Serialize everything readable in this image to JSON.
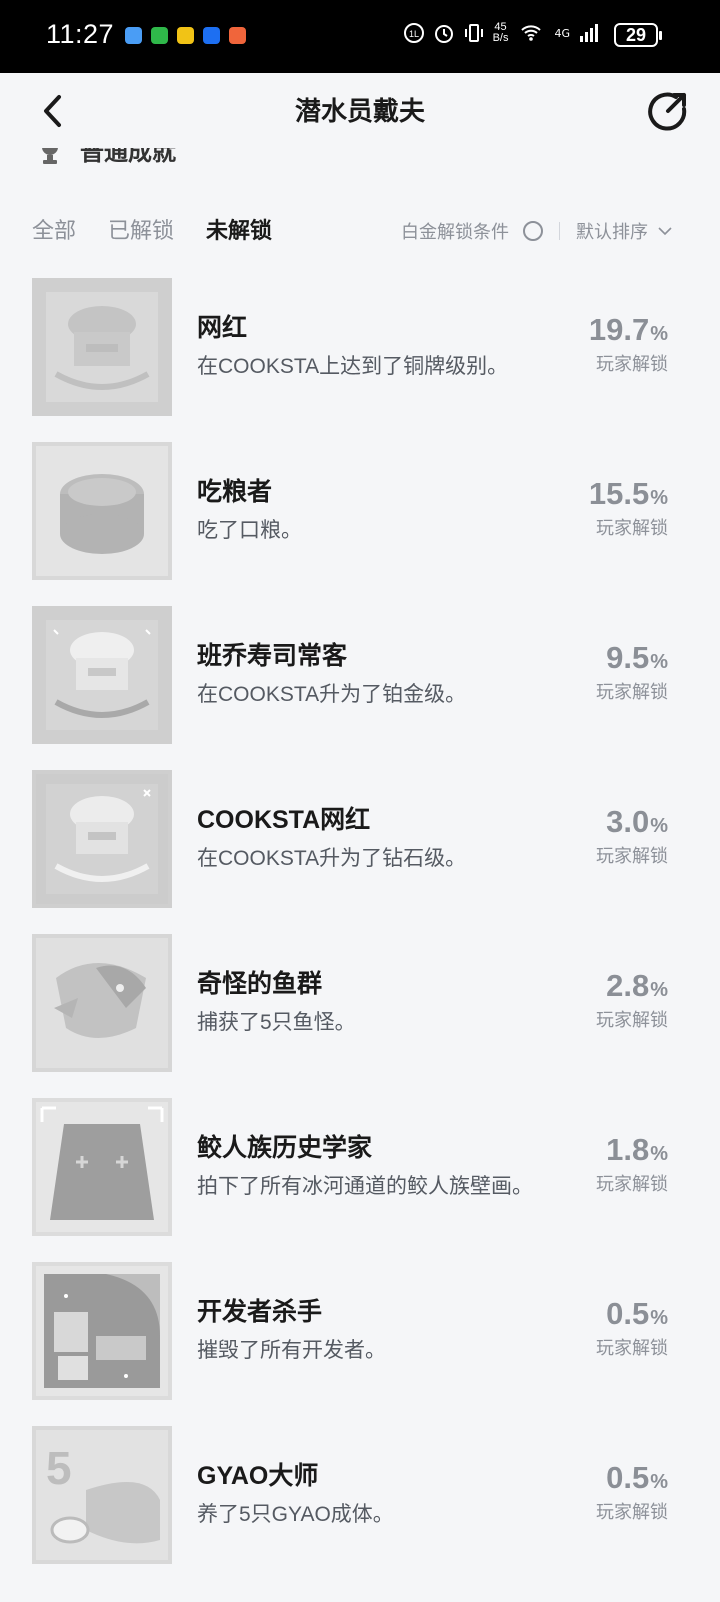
{
  "status_bar": {
    "time": "11:27",
    "net_speed_top": "45",
    "net_speed_bottom": "B/s",
    "network": "4G",
    "battery": "29"
  },
  "header": {
    "title": "潜水员戴夫"
  },
  "section_peek": "普通成就",
  "tabs": [
    "全部",
    "已解锁",
    "未解锁"
  ],
  "active_tab": "未解锁",
  "filters": {
    "platinum": "白金解锁条件",
    "sort": "默认排序"
  },
  "achievements": [
    {
      "name": "网红",
      "desc": "在COOKSTA上达到了铜牌级别。",
      "percent": "19.7",
      "label": "玩家解锁",
      "icon": "chef-hat-bronze-icon"
    },
    {
      "name": "吃粮者",
      "desc": "吃了口粮。",
      "percent": "15.5",
      "label": "玩家解锁",
      "icon": "ration-can-icon"
    },
    {
      "name": "班乔寿司常客",
      "desc": "在COOKSTA升为了铂金级。",
      "percent": "9.5",
      "label": "玩家解锁",
      "icon": "chef-hat-platinum-icon"
    },
    {
      "name": "COOKSTA网红",
      "desc": "在COOKSTA升为了钻石级。",
      "percent": "3.0",
      "label": "玩家解锁",
      "icon": "chef-hat-diamond-icon"
    },
    {
      "name": "奇怪的鱼群",
      "desc": "捕获了5只鱼怪。",
      "percent": "2.8",
      "label": "玩家解锁",
      "icon": "fish-monster-icon"
    },
    {
      "name": "鲛人族历史学家",
      "desc": "拍下了所有冰河通道的鲛人族壁画。",
      "percent": "1.8",
      "label": "玩家解锁",
      "icon": "mural-icon"
    },
    {
      "name": "开发者杀手",
      "desc": "摧毁了所有开发者。",
      "percent": "0.5",
      "label": "玩家解锁",
      "icon": "developer-icon"
    },
    {
      "name": "GYAO大师",
      "desc": "养了5只GYAO成体。",
      "percent": "0.5",
      "label": "玩家解锁",
      "icon": "gyao-icon"
    }
  ]
}
